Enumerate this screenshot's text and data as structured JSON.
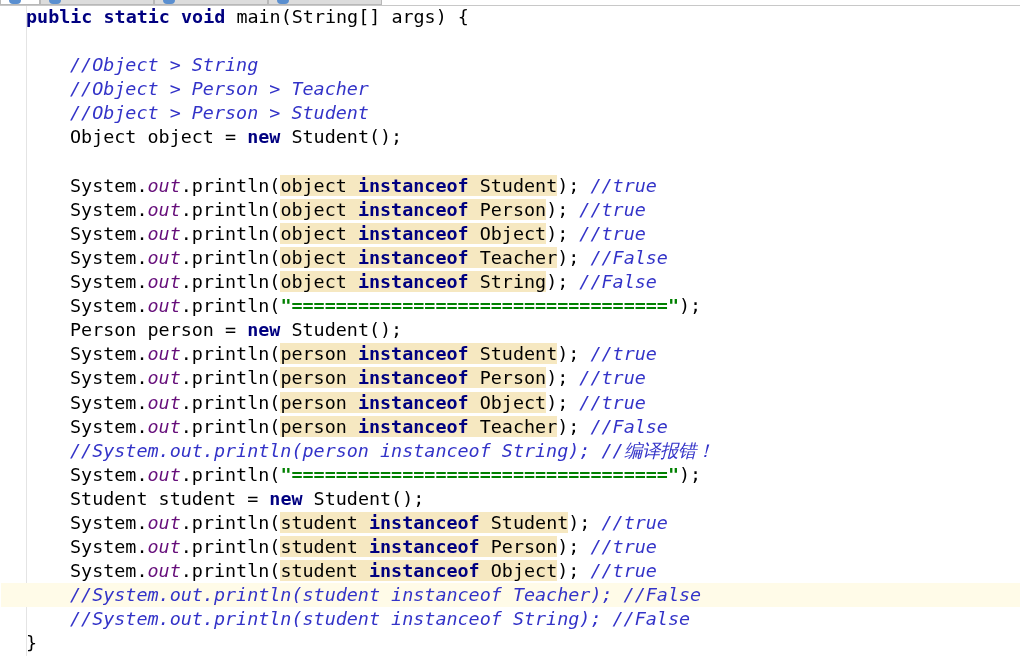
{
  "tabs": [
    {
      "selected": true
    },
    {
      "selected": false
    },
    {
      "selected": false
    },
    {
      "selected": false
    }
  ],
  "editor": {
    "header": {
      "current": false,
      "parts": [
        {
          "kind": "keyword",
          "text": "public static void "
        },
        {
          "kind": "plain",
          "text": "main(String[] args) {"
        }
      ]
    },
    "body": [
      {
        "current": false
      },
      {
        "current": false,
        "parts": [
          {
            "kind": "comment",
            "text": "//Object > String"
          }
        ]
      },
      {
        "current": false,
        "parts": [
          {
            "kind": "comment",
            "text": "//Object > Person > Teacher"
          }
        ]
      },
      {
        "current": false,
        "parts": [
          {
            "kind": "comment",
            "text": "//Object > Person > Student"
          }
        ]
      },
      {
        "current": false,
        "parts": [
          {
            "kind": "plain",
            "text": "Object object = "
          },
          {
            "kind": "keyword",
            "text": "new "
          },
          {
            "kind": "plain",
            "text": "Student();"
          }
        ]
      },
      {
        "current": false
      },
      {
        "current": false,
        "parts": [
          {
            "kind": "plain",
            "text": "System."
          },
          {
            "kind": "field",
            "text": "out"
          },
          {
            "kind": "plain",
            "text": ".println("
          },
          {
            "kind": "mark",
            "parts": [
              {
                "kind": "plain",
                "text": "object "
              },
              {
                "kind": "keyword",
                "text": "instanceof "
              },
              {
                "kind": "plain",
                "text": "Student"
              }
            ]
          },
          {
            "kind": "plain",
            "text": "); "
          },
          {
            "kind": "comment",
            "text": "//true"
          }
        ]
      },
      {
        "current": false,
        "parts": [
          {
            "kind": "plain",
            "text": "System."
          },
          {
            "kind": "field",
            "text": "out"
          },
          {
            "kind": "plain",
            "text": ".println("
          },
          {
            "kind": "mark",
            "parts": [
              {
                "kind": "plain",
                "text": "object "
              },
              {
                "kind": "keyword",
                "text": "instanceof "
              },
              {
                "kind": "plain",
                "text": "Person"
              }
            ]
          },
          {
            "kind": "plain",
            "text": "); "
          },
          {
            "kind": "comment",
            "text": "//true"
          }
        ]
      },
      {
        "current": false,
        "parts": [
          {
            "kind": "plain",
            "text": "System."
          },
          {
            "kind": "field",
            "text": "out"
          },
          {
            "kind": "plain",
            "text": ".println("
          },
          {
            "kind": "mark",
            "parts": [
              {
                "kind": "plain",
                "text": "object "
              },
              {
                "kind": "keyword",
                "text": "instanceof "
              },
              {
                "kind": "plain",
                "text": "Object"
              }
            ]
          },
          {
            "kind": "plain",
            "text": "); "
          },
          {
            "kind": "comment",
            "text": "//true"
          }
        ]
      },
      {
        "current": false,
        "parts": [
          {
            "kind": "plain",
            "text": "System."
          },
          {
            "kind": "field",
            "text": "out"
          },
          {
            "kind": "plain",
            "text": ".println("
          },
          {
            "kind": "mark",
            "parts": [
              {
                "kind": "plain",
                "text": "object "
              },
              {
                "kind": "keyword",
                "text": "instanceof "
              },
              {
                "kind": "plain",
                "text": "Teacher"
              }
            ]
          },
          {
            "kind": "plain",
            "text": "); "
          },
          {
            "kind": "comment",
            "text": "//False"
          }
        ]
      },
      {
        "current": false,
        "parts": [
          {
            "kind": "plain",
            "text": "System."
          },
          {
            "kind": "field",
            "text": "out"
          },
          {
            "kind": "plain",
            "text": ".println("
          },
          {
            "kind": "mark",
            "parts": [
              {
                "kind": "plain",
                "text": "object "
              },
              {
                "kind": "keyword",
                "text": "instanceof "
              },
              {
                "kind": "plain",
                "text": "String"
              }
            ]
          },
          {
            "kind": "plain",
            "text": "); "
          },
          {
            "kind": "comment",
            "text": "//False"
          }
        ]
      },
      {
        "current": false,
        "parts": [
          {
            "kind": "plain",
            "text": "System."
          },
          {
            "kind": "field",
            "text": "out"
          },
          {
            "kind": "plain",
            "text": ".println("
          },
          {
            "kind": "string",
            "text": "\"==================================\""
          },
          {
            "kind": "plain",
            "text": ");"
          }
        ]
      },
      {
        "current": false,
        "parts": [
          {
            "kind": "plain",
            "text": "Person person = "
          },
          {
            "kind": "keyword",
            "text": "new "
          },
          {
            "kind": "plain",
            "text": "Student();"
          }
        ]
      },
      {
        "current": false,
        "parts": [
          {
            "kind": "plain",
            "text": "System."
          },
          {
            "kind": "field",
            "text": "out"
          },
          {
            "kind": "plain",
            "text": ".println("
          },
          {
            "kind": "mark",
            "parts": [
              {
                "kind": "plain",
                "text": "person "
              },
              {
                "kind": "keyword",
                "text": "instanceof "
              },
              {
                "kind": "plain",
                "text": "Student"
              }
            ]
          },
          {
            "kind": "plain",
            "text": "); "
          },
          {
            "kind": "comment",
            "text": "//true"
          }
        ]
      },
      {
        "current": false,
        "parts": [
          {
            "kind": "plain",
            "text": "System."
          },
          {
            "kind": "field",
            "text": "out"
          },
          {
            "kind": "plain",
            "text": ".println("
          },
          {
            "kind": "mark",
            "parts": [
              {
                "kind": "plain",
                "text": "person "
              },
              {
                "kind": "keyword",
                "text": "instanceof "
              },
              {
                "kind": "plain",
                "text": "Person"
              }
            ]
          },
          {
            "kind": "plain",
            "text": "); "
          },
          {
            "kind": "comment",
            "text": "//true"
          }
        ]
      },
      {
        "current": false,
        "parts": [
          {
            "kind": "plain",
            "text": "System."
          },
          {
            "kind": "field",
            "text": "out"
          },
          {
            "kind": "plain",
            "text": ".println("
          },
          {
            "kind": "mark",
            "parts": [
              {
                "kind": "plain",
                "text": "person "
              },
              {
                "kind": "keyword",
                "text": "instanceof "
              },
              {
                "kind": "plain",
                "text": "Object"
              }
            ]
          },
          {
            "kind": "plain",
            "text": "); "
          },
          {
            "kind": "comment",
            "text": "//true"
          }
        ]
      },
      {
        "current": false,
        "parts": [
          {
            "kind": "plain",
            "text": "System."
          },
          {
            "kind": "field",
            "text": "out"
          },
          {
            "kind": "plain",
            "text": ".println("
          },
          {
            "kind": "mark",
            "parts": [
              {
                "kind": "plain",
                "text": "person "
              },
              {
                "kind": "keyword",
                "text": "instanceof "
              },
              {
                "kind": "plain",
                "text": "Teacher"
              }
            ]
          },
          {
            "kind": "plain",
            "text": "); "
          },
          {
            "kind": "comment",
            "text": "//False"
          }
        ]
      },
      {
        "current": false,
        "parts": [
          {
            "kind": "comment",
            "text": "//System.out.println(person instanceof String); //编译报错！"
          }
        ]
      },
      {
        "current": false,
        "parts": [
          {
            "kind": "plain",
            "text": "System."
          },
          {
            "kind": "field",
            "text": "out"
          },
          {
            "kind": "plain",
            "text": ".println("
          },
          {
            "kind": "string",
            "text": "\"==================================\""
          },
          {
            "kind": "plain",
            "text": ");"
          }
        ]
      },
      {
        "current": false,
        "parts": [
          {
            "kind": "plain",
            "text": "Student student = "
          },
          {
            "kind": "keyword",
            "text": "new "
          },
          {
            "kind": "plain",
            "text": "Student();"
          }
        ]
      },
      {
        "current": false,
        "parts": [
          {
            "kind": "plain",
            "text": "System."
          },
          {
            "kind": "field",
            "text": "out"
          },
          {
            "kind": "plain",
            "text": ".println("
          },
          {
            "kind": "mark",
            "parts": [
              {
                "kind": "plain",
                "text": "student "
              },
              {
                "kind": "keyword",
                "text": "instanceof "
              },
              {
                "kind": "plain",
                "text": "Student"
              }
            ]
          },
          {
            "kind": "plain",
            "text": "); "
          },
          {
            "kind": "comment",
            "text": "//true"
          }
        ]
      },
      {
        "current": false,
        "parts": [
          {
            "kind": "plain",
            "text": "System."
          },
          {
            "kind": "field",
            "text": "out"
          },
          {
            "kind": "plain",
            "text": ".println("
          },
          {
            "kind": "mark",
            "parts": [
              {
                "kind": "plain",
                "text": "student "
              },
              {
                "kind": "keyword",
                "text": "instanceof "
              },
              {
                "kind": "plain",
                "text": "Person"
              }
            ]
          },
          {
            "kind": "plain",
            "text": "); "
          },
          {
            "kind": "comment",
            "text": "//true"
          }
        ]
      },
      {
        "current": false,
        "parts": [
          {
            "kind": "plain",
            "text": "System."
          },
          {
            "kind": "field",
            "text": "out"
          },
          {
            "kind": "plain",
            "text": ".println("
          },
          {
            "kind": "mark",
            "parts": [
              {
                "kind": "plain",
                "text": "student "
              },
              {
                "kind": "keyword",
                "text": "instanceof "
              },
              {
                "kind": "plain",
                "text": "Object"
              }
            ]
          },
          {
            "kind": "plain",
            "text": "); "
          },
          {
            "kind": "comment",
            "text": "//true"
          }
        ]
      },
      {
        "current": true,
        "parts": [
          {
            "kind": "comment",
            "text": "//System.out.println(student instanceof Teacher); //False"
          }
        ]
      },
      {
        "current": false,
        "parts": [
          {
            "kind": "comment",
            "text": "//System.out.println(student instanceof String); //False"
          }
        ]
      }
    ],
    "footer": {
      "current": false,
      "parts": [
        {
          "kind": "plain",
          "text": "}"
        }
      ]
    }
  }
}
